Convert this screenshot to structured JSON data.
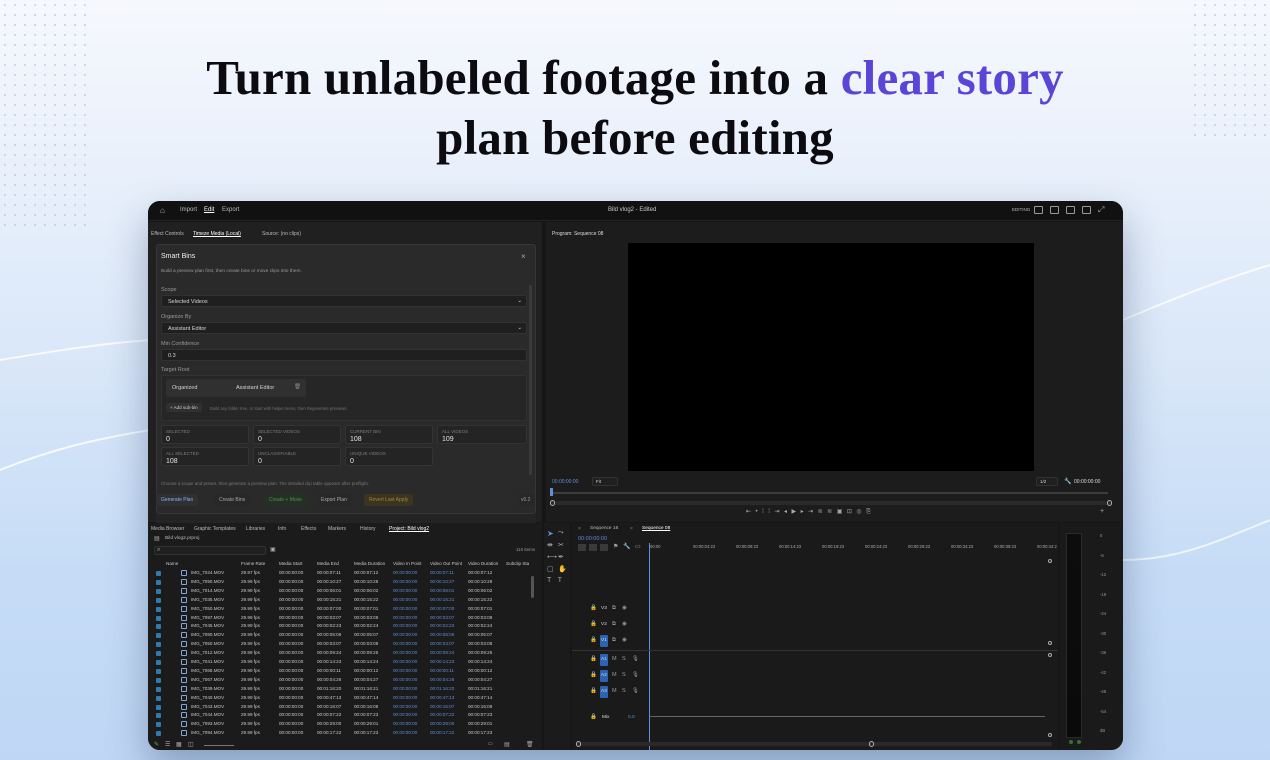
{
  "headline": {
    "part1": "Turn unlabeled footage into a ",
    "accent": "clear story",
    "part2": "plan before editing"
  },
  "colors": {
    "accent": "#5b45d6",
    "app_bg": "#161616",
    "clip_blue": "#2f7aa8"
  },
  "app": {
    "menu": [
      "Import",
      "Edit",
      "Export"
    ],
    "window_title": "Bild vlog2 - Edited",
    "workspace_label": "EDITING",
    "source_tabs": [
      "Effect Controls",
      "Timeze Media (Local)",
      "Source: (no clips)"
    ],
    "program_title": "Program: Sequence 08",
    "program_timecode_left": "00:00:00:00",
    "program_fit": "Fit",
    "program_quality": "1/2",
    "program_timecode_right": "00:00:00:00"
  },
  "smart_bins": {
    "title": "Smart Bins",
    "subtitle": "Build a preview plan first, then create bins or move clips into them.",
    "scope_label": "Scope",
    "scope_value": "Selected Videos",
    "organize_label": "Organize By",
    "organize_value": "Assistant Editor",
    "min_conf_label": "Min Confidence",
    "min_conf_value": "0.3",
    "target_root_label": "Target Root",
    "root_chip1": "Organized",
    "root_chip2": "Assistant Editor",
    "add_sub_label": "+ Add sub-bin",
    "add_sub_hint": "Build any folder tree, or start with helper items, then Regenerate previews.",
    "stats": [
      {
        "key": "SELECTED",
        "value": "0"
      },
      {
        "key": "SELECTED VIDEOS",
        "value": "0"
      },
      {
        "key": "CURRENT BIN",
        "value": "108"
      },
      {
        "key": "ALL VIDEOS",
        "value": "109"
      },
      {
        "key": "ALL SELECTED",
        "value": "108"
      },
      {
        "key": "UNCLASSIFIABLE",
        "value": "0"
      },
      {
        "key": "UNIQUE VIDEOS",
        "value": "0"
      }
    ],
    "footer_hint": "Choose a scope and preset, then generate a preview plan. The detailed clip table appears after preflight.",
    "actions": [
      "Generate Plan",
      "Create Bins",
      "Create + Move",
      "Export Plan",
      "Revert Last Apply"
    ],
    "version": "v0.2"
  },
  "project": {
    "tabs": [
      "Media Browser",
      "Graphic Templates",
      "Libraries",
      "Info",
      "Effects",
      "Markers",
      "History",
      "Project: Bild vlog2"
    ],
    "path": "Bild vlog2.prproj",
    "item_count": "110 items",
    "columns": [
      "Name",
      "Frame Rate",
      "Media Start",
      "Media End",
      "Media Duration",
      "Video In Point",
      "Video Out Point",
      "Video Duration",
      "Subclip Sta"
    ],
    "rows": [
      [
        "IMG_7024.MOV",
        "29.97 fps",
        "00:00:00:00",
        "00:00:07:11",
        "00:00:07:12",
        "00:00:00:00",
        "00:00:07:11",
        "00:00:07:12"
      ],
      [
        "IMG_7090.MOV",
        "29.99 fps",
        "00:00:00:00",
        "00:00:10:27",
        "00:00:10:28",
        "00:00:00:00",
        "00:00:10:27",
        "00:00:10:28"
      ],
      [
        "IMG_7014.MOV",
        "29.99 fps",
        "00:00:00:00",
        "00:00:06:01",
        "00:00:06:02",
        "00:00:00:00",
        "00:00:06:01",
        "00:00:06:02"
      ],
      [
        "IMG_7035.MOV",
        "29.99 fps",
        "00:00:00:00",
        "00:00:15:21",
        "00:00:15:22",
        "00:00:00:00",
        "00:00:15:21",
        "00:00:15:22"
      ],
      [
        "IMG_7050.MOV",
        "29.99 fps",
        "00:00:00:00",
        "00:00:07:00",
        "00:00:07:01",
        "00:00:00:00",
        "00:00:07:00",
        "00:00:07:01"
      ],
      [
        "IMG_7097.MOV",
        "29.99 fps",
        "00:00:00:00",
        "00:00:03:07",
        "00:00:03:08",
        "00:00:00:00",
        "00:00:03:07",
        "00:00:03:08"
      ],
      [
        "IMG_7045.MOV",
        "29.99 fps",
        "00:00:00:00",
        "00:00:02:23",
        "00:00:02:24",
        "00:00:00:00",
        "00:00:02:23",
        "00:00:02:24"
      ],
      [
        "IMG_7080.MOV",
        "29.99 fps",
        "00:00:00:00",
        "00:00:05:06",
        "00:00:05:07",
        "00:00:00:00",
        "00:00:05:06",
        "00:00:05:07"
      ],
      [
        "IMG_7050.MOV",
        "29.99 fps",
        "00:00:00:00",
        "00:00:03:07",
        "00:00:03:08",
        "00:00:00:00",
        "00:00:03:07",
        "00:00:03:08"
      ],
      [
        "IMG_7012.MOV",
        "29.99 fps",
        "00:00:00:00",
        "00:00:09:24",
        "00:00:09:25",
        "00:00:00:00",
        "00:00:09:24",
        "00:00:09:25"
      ],
      [
        "IMG_7041.MOV",
        "29.99 fps",
        "00:00:00:00",
        "00:00:14:23",
        "00:00:14:24",
        "00:00:00:00",
        "00:00:14:23",
        "00:00:14:24"
      ],
      [
        "IMG_7068.MOV",
        "29.99 fps",
        "00:00:00:00",
        "00:00:00:11",
        "00:00:00:12",
        "00:00:00:00",
        "00:00:00:11",
        "00:00:00:12"
      ],
      [
        "IMG_7067.MOV",
        "29.99 fps",
        "00:00:00:00",
        "00:00:04:26",
        "00:00:04:27",
        "00:00:00:00",
        "00:00:04:26",
        "00:00:04:27"
      ],
      [
        "IMG_7039.MOV",
        "29.99 fps",
        "00:00:00:00",
        "00:01:16:20",
        "00:01:16:21",
        "00:00:00:00",
        "00:01:16:20",
        "00:01:16:21"
      ],
      [
        "IMG_7040.MOV",
        "29.99 fps",
        "00:00:00:00",
        "00:00:47:13",
        "00:00:47:14",
        "00:00:00:00",
        "00:00:47:13",
        "00:00:47:14"
      ],
      [
        "IMG_7043.MOV",
        "29.99 fps",
        "00:00:00:00",
        "00:00:16:07",
        "00:00:16:08",
        "00:00:00:00",
        "00:00:16:07",
        "00:00:16:08"
      ],
      [
        "IMG_7044.MOV",
        "29.99 fps",
        "00:00:00:00",
        "00:00:07:22",
        "00:00:07:23",
        "00:00:00:00",
        "00:00:07:22",
        "00:00:07:23"
      ],
      [
        "IMG_7093.MOV",
        "29.99 fps",
        "00:00:00:00",
        "00:00:29:00",
        "00:00:29:01",
        "00:00:00:00",
        "00:00:29:00",
        "00:00:29:01"
      ],
      [
        "IMG_7094.MOV",
        "29.99 fps",
        "00:00:00:00",
        "00:00:17:22",
        "00:00:17:23",
        "00:00:00:00",
        "00:00:17:22",
        "00:00:17:23"
      ]
    ]
  },
  "timeline": {
    "tabs": [
      "Sequence 16",
      "Sequence 08"
    ],
    "timecode": "00:00:00:00",
    "ruler": [
      "00:00",
      "00:00:04:23",
      "00:00:09:23",
      "00:00:14:23",
      "00:00:19:23",
      "00:00:24:23",
      "00:00:29:23",
      "00:00:34:23",
      "00:00:39:23",
      "00:00:44:2"
    ],
    "tracks": [
      "V3",
      "V2",
      "V1",
      "A1",
      "A2",
      "A3",
      "Mix"
    ],
    "mix_value": "0.0",
    "meter_scale": [
      "0",
      "-6",
      "-12",
      "-18",
      "-24",
      "-30",
      "-36",
      "-42",
      "-48",
      "-54",
      "dB"
    ]
  }
}
